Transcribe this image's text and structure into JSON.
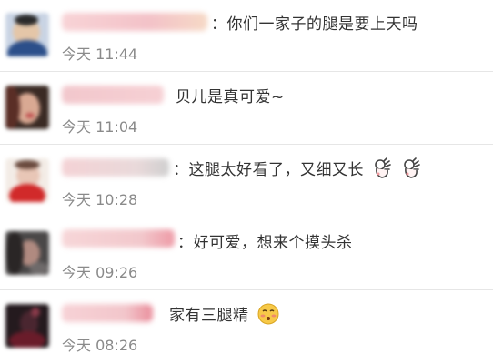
{
  "comments": [
    {
      "text": "：你们一家子的腿是要上天吗",
      "time": "今天 11:44",
      "emoji": []
    },
    {
      "text": "贝儿是真可爱~",
      "time": "今天 11:04",
      "emoji": []
    },
    {
      "text": "：这腿太好看了，又细又长",
      "time": "今天 10:28",
      "emoji": [
        "ok-hand-emoji",
        "ok-hand-emoji"
      ]
    },
    {
      "text": "：好可爱，想来个摸头杀",
      "time": "今天 09:26",
      "emoji": []
    },
    {
      "text": "家有三腿精",
      "time": "今天 08:26",
      "emoji": [
        "shy-face-emoji"
      ]
    }
  ],
  "colors": {
    "comment_text": "#333333",
    "timestamp": "#8a8a8a",
    "divider": "#e6e6e6",
    "username_blur": "#f6c9cf"
  }
}
